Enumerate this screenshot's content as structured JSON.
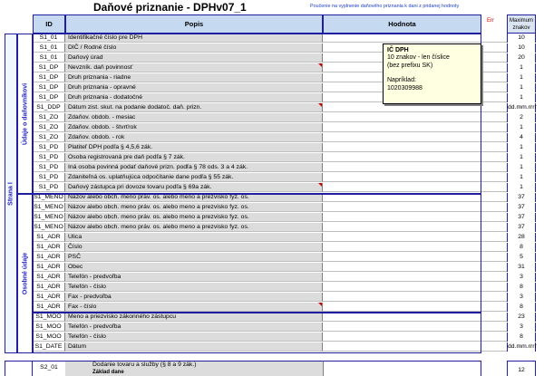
{
  "title": "Daňové priznanie - DPHv07_1",
  "help_link": "Poučenie na vyplnenie daňového priznania k dani z pridanej hodnoty",
  "headers": {
    "id": "ID",
    "popis": "Popis",
    "hodnota": "Hodnota",
    "err": "Err",
    "max": "Maximum znakov"
  },
  "section_main": "Strana I",
  "section_a": "Údaje o daňovníkovi",
  "section_b": "Osobné údaje",
  "tooltip": {
    "title": "IČ DPH",
    "line1": "10 znakov - len číslice",
    "line2": "(bez prefixu SK)",
    "line3": "Napríklad:",
    "line4": "1020309988"
  },
  "rows": [
    {
      "id": "S1_01",
      "desc": "Identifikačné číslo pre DPH",
      "max": "10",
      "flag": false
    },
    {
      "id": "S1_01",
      "desc": "DIČ / Rodné číslo",
      "max": "10",
      "flag": false
    },
    {
      "id": "S1_01",
      "desc": "Daňový úrad",
      "max": "20",
      "flag": false
    },
    {
      "id": "S1_DP",
      "desc": "Nevzník. daň povinnosť",
      "max": "1",
      "flag": true
    },
    {
      "id": "S1_DP",
      "desc": "Druh priznania - riadne",
      "max": "1",
      "flag": false
    },
    {
      "id": "S1_DP",
      "desc": "Druh priznania - opravné",
      "max": "1",
      "flag": false
    },
    {
      "id": "S1_DP",
      "desc": "Druh priznania - dodatočné",
      "max": "1",
      "flag": false
    },
    {
      "id": "S1_DDP",
      "desc": "Dátum zist. skut. na podanie dodatoč. daň. prizn.",
      "max": "dd.mm.rrrr",
      "flag": true
    },
    {
      "id": "S1_ZO",
      "desc": "Zdaňov. obdob. - mesiac",
      "max": "2",
      "flag": false
    },
    {
      "id": "S1_ZO",
      "desc": "Zdaňov. obdob. - štvrťrok",
      "max": "1",
      "flag": false
    },
    {
      "id": "S1_ZO",
      "desc": "Zdaňov. obdob. - rok",
      "max": "4",
      "flag": false
    },
    {
      "id": "S1_PD",
      "desc": "Platiteľ DPH podľa § 4,5,6 zák.",
      "max": "1",
      "flag": false
    },
    {
      "id": "S1_PD",
      "desc": "Osoba registrovaná pre daň podľa § 7 zák.",
      "max": "1",
      "flag": false
    },
    {
      "id": "S1_PD",
      "desc": "Iná osoba povinná podať daňové prizn. podľa § 78 ods. 3 a 4 zák.",
      "max": "1",
      "flag": false
    },
    {
      "id": "S1_PD",
      "desc": "Zdaniteľná os. uplatňujúca odpočítanie dane podľa § 55 zák.",
      "max": "1",
      "flag": false
    },
    {
      "id": "S1_PD",
      "desc": "Daňový zástupca pri dovoze tovaru podľa § 69a zák.",
      "max": "1",
      "flag": true
    },
    {
      "id": "S1_MENO",
      "desc": "Názov alebo obch. meno práv. os. alebo meno a prezvisko fyz. os.",
      "max": "37",
      "flag": false
    },
    {
      "id": "S1_MENO",
      "desc": "Názov alebo obch. meno práv. os. alebo meno a prezvisko fyz. os.",
      "max": "37",
      "flag": false
    },
    {
      "id": "S1_MENO",
      "desc": "Názov alebo obch. meno práv. os. alebo meno a prezvisko fyz. os.",
      "max": "37",
      "flag": false
    },
    {
      "id": "S1_MENO",
      "desc": "Názov alebo obch. meno práv. os. alebo meno a prezvisko fyz. os.",
      "max": "37",
      "flag": false
    },
    {
      "id": "S1_ADR",
      "desc": "Ulica",
      "max": "28",
      "flag": false
    },
    {
      "id": "S1_ADR",
      "desc": "Číslo",
      "max": "8",
      "flag": false
    },
    {
      "id": "S1_ADR",
      "desc": "PSČ",
      "max": "5",
      "flag": false
    },
    {
      "id": "S1_ADR",
      "desc": "Obec",
      "max": "31",
      "flag": false
    },
    {
      "id": "S1_ADR",
      "desc": "Telefón - predvoľba",
      "max": "3",
      "flag": false
    },
    {
      "id": "S1_ADR",
      "desc": "Telefón - číslo",
      "max": "8",
      "flag": false
    },
    {
      "id": "S1_ADR",
      "desc": "Fax - predvoľba",
      "max": "3",
      "flag": false
    },
    {
      "id": "S1_ADR",
      "desc": "Fax - číslo",
      "max": "8",
      "flag": true
    },
    {
      "id": "S1_MOO",
      "desc": "Meno a priezvisko zákonného zástupcu",
      "max": "23",
      "flag": false
    },
    {
      "id": "S1_MOO",
      "desc": "Telefón - predvoľba",
      "max": "3",
      "flag": false
    },
    {
      "id": "S1_MOO",
      "desc": "Telefón - číslo",
      "max": "8",
      "flag": false
    },
    {
      "id": "S1_DATE",
      "desc": "Dátum",
      "max": "dd.mm.rrrr",
      "flag": false
    }
  ],
  "bottom": {
    "id": "S2_01",
    "desc": "Dodanie tovaru a služby (§ 8 a 9 zák.)",
    "desc2": "Základ dane",
    "max": "12"
  }
}
